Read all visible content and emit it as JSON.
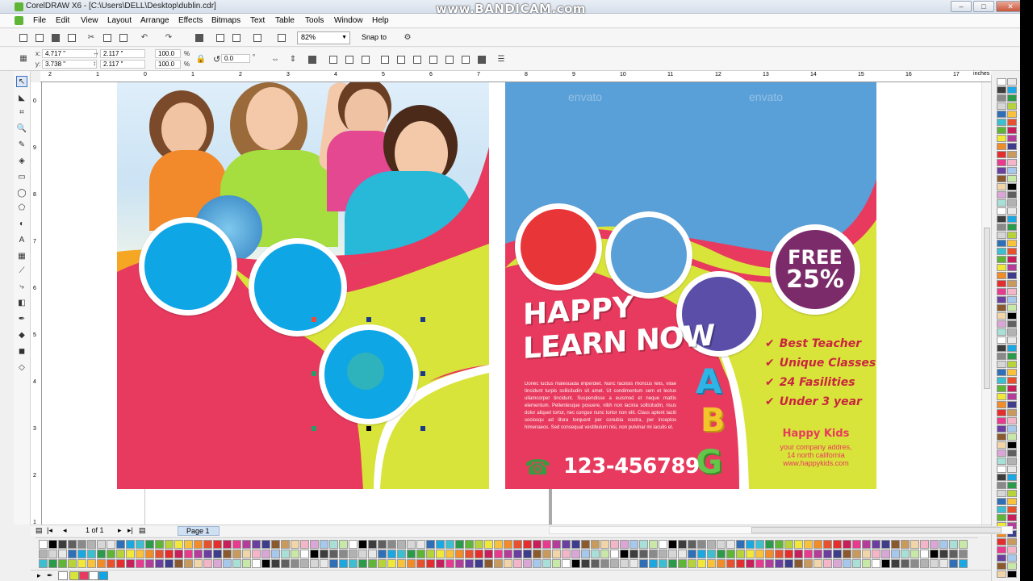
{
  "window": {
    "title": "CorelDRAW X6 - [C:\\Users\\DELL\\Desktop\\dublin.cdr]",
    "watermark": "www.BANDICAM.com",
    "minimize": "–",
    "maximize": "□",
    "close": "✕"
  },
  "menu": [
    "File",
    "Edit",
    "View",
    "Layout",
    "Arrange",
    "Effects",
    "Bitmaps",
    "Text",
    "Table",
    "Tools",
    "Window",
    "Help"
  ],
  "toolbar": {
    "zoom_value": "82%",
    "snap_label": "Snap to"
  },
  "propbar": {
    "x_label": "x:",
    "x_value": "4.717 \"",
    "y_label": "y:",
    "y_value": "3.738 \"",
    "w_value": "2.117 \"",
    "h_value": "2.117 \"",
    "scale_w": "100.0",
    "scale_h": "100.0",
    "percent": "%",
    "rotation": "0.0",
    "degree": "°"
  },
  "ruler": {
    "units": "inches",
    "h_ticks": [
      "2",
      "1",
      "0",
      "1",
      "2",
      "3",
      "4",
      "5",
      "6",
      "7",
      "8",
      "9",
      "10",
      "11",
      "12",
      "13",
      "14",
      "15",
      "16",
      "17"
    ],
    "v_ticks": [
      "0",
      "9",
      "8",
      "7",
      "6",
      "5",
      "4",
      "3",
      "2",
      "1"
    ]
  },
  "pagebar": {
    "page_count": "1 of 1",
    "tab_label": "Page 1"
  },
  "flyer_left": {
    "circle_colors": [
      "#0fa6e6",
      "#0fa6e6",
      "#0fa6e6"
    ],
    "accent": "#e83a5e",
    "lime": "#d9e43a"
  },
  "flyer_right": {
    "envato_1": "envato",
    "envato_2": "envato",
    "headline_1": "HAPPY",
    "headline_2": "LEARN NOW",
    "body": "Donec luctus malesuada imperdiet. Nunc facilisis rhoncus felis, vitae tincidunt turpis sollicitudin sit amet. Ut condimentum sem et lectus ullamcorper tincidunt. Suspendisse a euismod et neque mattis elementum. Pellentesque posuere, nibh non lacinia sollicitudin, risus dolor aliquet tortor, nec congue nunc tortor non elit. Class aptent taciti sociosqu ad litora torquent per conubia nostra, per inceptos himenaeos. Sed consequat vestibulum nisi, non pulvinar mi iaculis et.",
    "free_1": "FREE",
    "free_2": "25%",
    "features": [
      "Best Teacher",
      "Unique Classes",
      "24 Fasilities",
      "Under 3 year"
    ],
    "brand": "Happy Kids",
    "address_1": "your company addres,",
    "address_2": "14 north california",
    "website": "www.happykids.com",
    "phone": "123-456789",
    "letters": [
      "A",
      "B",
      "G"
    ],
    "circle_colors": [
      "#e83538",
      "#5aa0d8",
      "#5a4ea8"
    ],
    "free_circle_color": "#7b2a6a",
    "sky_color": "#5aa0d8"
  },
  "palette_colors": [
    "#ffffff",
    "#000000",
    "#3d3d3d",
    "#606060",
    "#8a8a8a",
    "#b2b2b2",
    "#d6d6d6",
    "#e8e8e8",
    "#2e6fb8",
    "#1ba7e0",
    "#3cbfd0",
    "#2b9a4a",
    "#5fb536",
    "#b6d33a",
    "#f2e83a",
    "#f9c23a",
    "#f28c28",
    "#e8512e",
    "#e52d2d",
    "#c81e5c",
    "#e83a8e",
    "#b43c9b",
    "#6b3fa0",
    "#3d3d8c",
    "#8a5a2e",
    "#c89a5e",
    "#f1d4a8",
    "#f5b5c8",
    "#d9a6d6",
    "#a6c8ec",
    "#a8e0d8",
    "#c8e8a8"
  ],
  "page1": {
    "blue_circle_color": "#0fa6e6"
  }
}
